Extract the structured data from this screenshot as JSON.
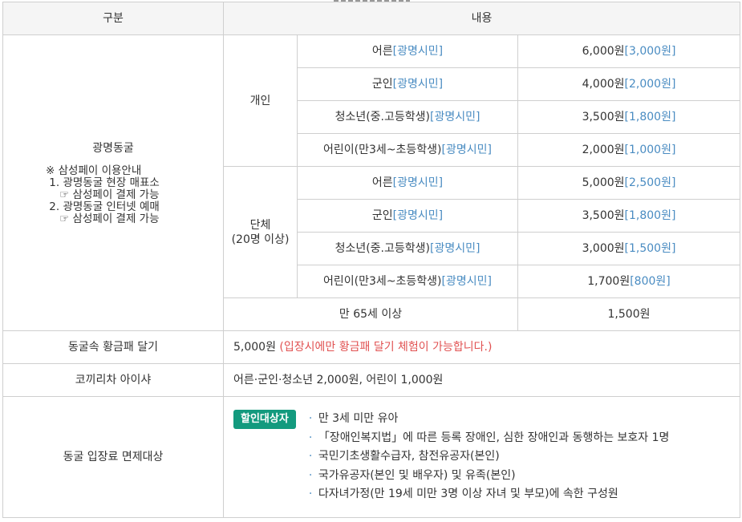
{
  "header": {
    "col1": "구분",
    "col2": "내용"
  },
  "cave": {
    "title": "광명동굴",
    "note": "※ 삼성페이 이용안내\n 1. 광명동굴 현장 매표소\n    ☞ 삼성페이 결제 가능\n 2. 광명동굴 인터넷 예매\n    ☞ 삼성페이 결제 가능"
  },
  "individual": {
    "label": "개인",
    "rows": [
      {
        "category": "어른",
        "tag": "[광명시민]",
        "price": "6,000원",
        "discount": "[3,000원]"
      },
      {
        "category": "군인",
        "tag": "[광명시민]",
        "price": "4,000원",
        "discount": "[2,000원]"
      },
      {
        "category": "청소년(중.고등학생)",
        "tag": "[광명시민]",
        "price": "3,500원",
        "discount": "[1,800원]"
      },
      {
        "category": "어린이(만3세~초등학생)",
        "tag": "[광명시민]",
        "price": "2,000원",
        "discount": "[1,000원]"
      }
    ]
  },
  "group": {
    "label": "단체",
    "sublabel": "(20명 이상)",
    "rows": [
      {
        "category": "어른",
        "tag": "[광명시민]",
        "price": "5,000원",
        "discount": "[2,500원]"
      },
      {
        "category": "군인",
        "tag": "[광명시민]",
        "price": "3,500원",
        "discount": "[1,800원]"
      },
      {
        "category": "청소년(중.고등학생)",
        "tag": "[광명시민]",
        "price": "3,000원",
        "discount": "[1,500원]"
      },
      {
        "category": "어린이(만3세~초등학생)",
        "tag": "[광명시민]",
        "price": "1,700원",
        "discount": "[800원]"
      }
    ]
  },
  "senior": {
    "label": "만 65세 이상",
    "price": "1,500원"
  },
  "gold": {
    "label": "동굴속 황금패 달기",
    "price": "5,000원",
    "note": "(입장시에만 황금패 달기 체험이 가능합니다.)"
  },
  "train": {
    "label": "코끼리차 아이샤",
    "content": "어른·군인·청소년 2,000원, 어린이 1,000원"
  },
  "exempt": {
    "label": "동굴 입장료 면제대상",
    "badge": "할인대상자",
    "items": [
      "만 3세 미만 유아",
      "「장애인복지법」에 따른 등록 장애인, 심한 장애인과 동행하는 보호자 1명",
      "국민기초생활수급자, 참전유공자(본인)",
      "국가유공자(본인 및 배우자) 및 유족(본인)",
      "다자녀가정(만 19세 미만 3명 이상 자녀 및 부모)에 속한 구성원"
    ]
  },
  "colors": {
    "blue": "#4a8cc2",
    "red": "#e15252",
    "badge": "#139a7e",
    "header_bg": "#f5f5f5",
    "border": "#cfcfcf"
  }
}
